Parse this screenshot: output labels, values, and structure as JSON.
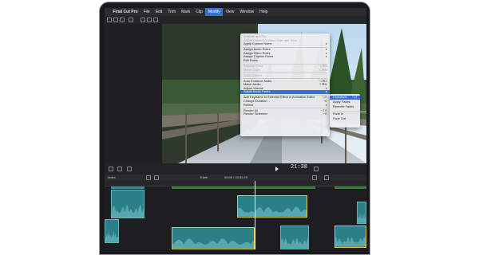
{
  "menubar": {
    "apple": "",
    "items": [
      "Final Cut Pro",
      "File",
      "Edit",
      "Trim",
      "Mark",
      "Clip",
      "Modify",
      "View",
      "Window",
      "Help"
    ],
    "active": "Modify"
  },
  "modify_menu": {
    "items": [
      {
        "label": "Analyze and Fix...",
        "shortcut": "",
        "disabled": true
      },
      {
        "label": "Adjust Content Created Date and Time...",
        "shortcut": "",
        "disabled": true
      },
      {
        "label": "Apply Custom Name",
        "shortcut": "▸",
        "disabled": false
      },
      {
        "sep": true
      },
      {
        "label": "Assign Audio Roles",
        "shortcut": "▸",
        "disabled": false
      },
      {
        "label": "Assign Video Roles",
        "shortcut": "▸",
        "disabled": false
      },
      {
        "label": "Assign Caption Roles",
        "shortcut": "▸",
        "disabled": false
      },
      {
        "label": "Edit Roles...",
        "shortcut": "",
        "disabled": false
      },
      {
        "sep": true
      },
      {
        "label": "Balance Color",
        "shortcut": "⌥⌘B",
        "disabled": true
      },
      {
        "label": "Match Color...",
        "shortcut": "⌥⌘M",
        "disabled": true
      },
      {
        "sep": true
      },
      {
        "label": "Color Correct",
        "shortcut": "",
        "disabled": true
      },
      {
        "sep": true
      },
      {
        "label": "Auto Enhance Audio",
        "shortcut": "⌥⌘A",
        "disabled": false
      },
      {
        "label": "Match Audio...",
        "shortcut": "⇧⌘M",
        "disabled": false
      },
      {
        "label": "Adjust Volume",
        "shortcut": "▸",
        "disabled": false
      },
      {
        "label": "Adjust Audio Fades",
        "shortcut": "▸",
        "disabled": false,
        "highlight": true
      },
      {
        "sep": true
      },
      {
        "label": "Add Keyframe to Selected Effect in Animation Editor",
        "shortcut": "⌥K",
        "disabled": false
      },
      {
        "label": "Change Duration...",
        "shortcut": "^D",
        "disabled": false
      },
      {
        "label": "Retime",
        "shortcut": "▸",
        "disabled": false
      },
      {
        "sep": true
      },
      {
        "label": "Render All",
        "shortcut": "^⇧R",
        "disabled": false
      },
      {
        "label": "Render Selection",
        "shortcut": "^R",
        "disabled": false
      }
    ]
  },
  "fades_submenu": {
    "items": [
      {
        "label": "Crossfade",
        "shortcut": "⌥T",
        "highlight": true
      },
      {
        "label": "Apply Fades",
        "shortcut": ""
      },
      {
        "label": "Remove Fades",
        "shortcut": ""
      },
      {
        "sep": true
      },
      {
        "label": "Fade In",
        "shortcut": ""
      },
      {
        "label": "Fade Out",
        "shortcut": ""
      }
    ]
  },
  "viewer": {
    "timecode": "21:38"
  },
  "timeline": {
    "toolbar_label": "Index",
    "project_name": "Earth",
    "duration": "00:00 / 03:32:29"
  },
  "colors": {
    "accent": "#3b6fd8",
    "clip_teal": "#2b7f86",
    "clip_selected": "#d9c84a"
  }
}
